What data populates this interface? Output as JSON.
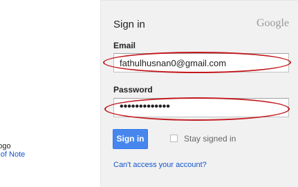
{
  "left": {
    "line1": "er logo",
    "line2": "ogs of Note"
  },
  "form": {
    "title": "Sign in",
    "brand": "Google",
    "email_label": "Email",
    "email_value": "fathulhusnan0@gmail.com",
    "password_label": "Password",
    "password_value": "•••••••••••••",
    "sign_in_button": "Sign in",
    "stay_signed_in": "Stay signed in",
    "stay_signed_in_checked": false,
    "help_link": "Can't access your account?"
  },
  "annotation_color": "#c2171c",
  "button_color": "#4787ed"
}
